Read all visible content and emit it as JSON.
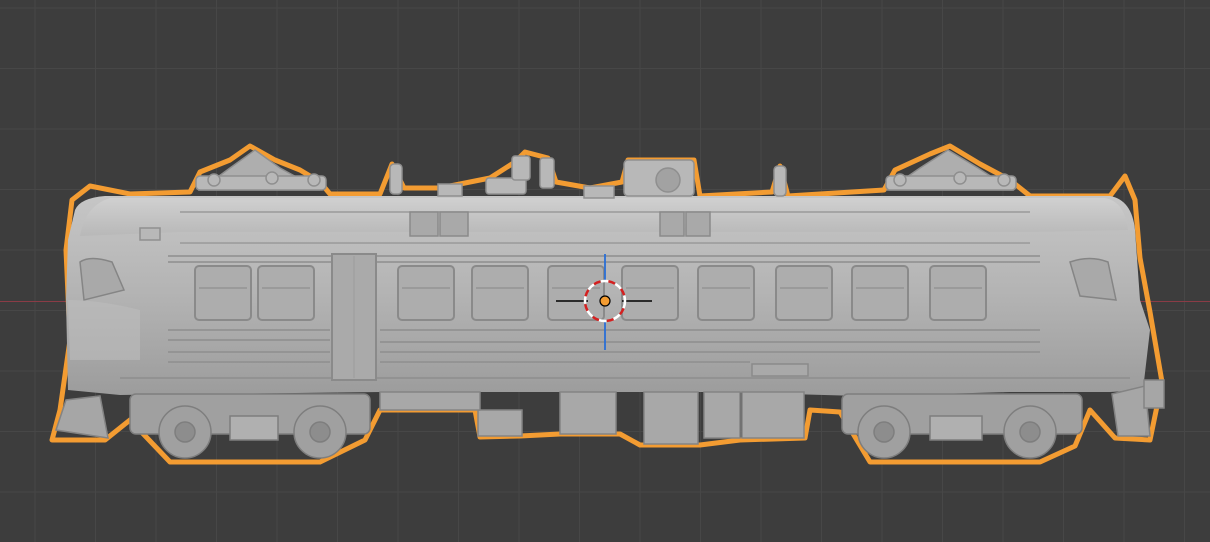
{
  "viewport": {
    "background": "#3d3d3d",
    "grid_color": "#474747",
    "x_axis_color": "#8a3c46",
    "selection_outline_color": "#f39c32",
    "model_color": "#b4b4b4"
  },
  "scene": {
    "selected_object": "train-model",
    "cursor": "3d-cursor",
    "origin": "object-origin-dot"
  }
}
